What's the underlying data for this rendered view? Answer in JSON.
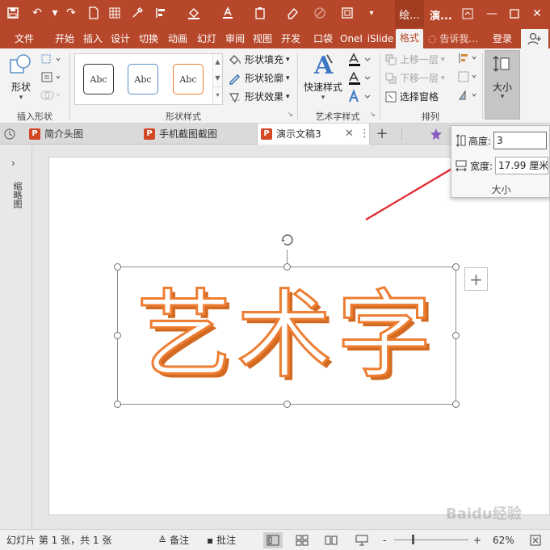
{
  "titlebar": {
    "context_group": "绘...",
    "doc_title": "演...",
    "icons": [
      "save-icon",
      "undo-icon",
      "redo-icon",
      "new-doc-icon",
      "grid-icon",
      "eyedropper-icon",
      "align-icon",
      "fill-bucket-icon",
      "font-color-icon",
      "clipboard-icon",
      "eraser-icon",
      "disabled-icon",
      "window-capture-icon"
    ]
  },
  "tabs": [
    {
      "label": "文件"
    },
    {
      "label": "开始"
    },
    {
      "label": "插入"
    },
    {
      "label": "设计"
    },
    {
      "label": "切换"
    },
    {
      "label": "动画"
    },
    {
      "label": "幻灯"
    },
    {
      "label": "审阅"
    },
    {
      "label": "视图"
    },
    {
      "label": "开发"
    },
    {
      "label": "口袋"
    },
    {
      "label": "OneI"
    },
    {
      "label": "iSlide"
    },
    {
      "label": "格式"
    }
  ],
  "tell_me": "告诉我...",
  "login": "登录",
  "ribbon": {
    "insert_shape": {
      "shape_label": "形状",
      "group_label": "插入形状"
    },
    "shape_styles": {
      "gallery": [
        "Abc",
        "Abc",
        "Abc"
      ],
      "fill": "形状填充",
      "outline": "形状轮廓",
      "effects": "形状效果",
      "group_label": "形状样式"
    },
    "wordart": {
      "quick_styles": "快速样式",
      "group_label": "艺术字样式"
    },
    "arrange": {
      "bring_forward": "上移一层",
      "send_backward": "下移一层",
      "selection_pane": "选择窗格",
      "group_label": "排列"
    },
    "size": {
      "label": "大小"
    }
  },
  "doc_tabs": [
    {
      "label": "简介头图"
    },
    {
      "label": "手机截图截图"
    },
    {
      "label": "演示文稿3"
    }
  ],
  "thumbs_label": "缩略图",
  "slide": {
    "wordart_text": "艺术字"
  },
  "size_popup": {
    "height_label": "高度:",
    "height_value": "3",
    "width_label": "宽度:",
    "width_value": "17.99 厘米",
    "footer": "大小"
  },
  "status": {
    "slide_info": "幻灯片 第 1 张，共 1 张",
    "notes": "备注",
    "comments": "批注",
    "zoom_minus": "-",
    "zoom_plus": "+",
    "zoom": "62%"
  },
  "watermark": "Baidu经验",
  "colors": {
    "accent": "#b7472a",
    "wordart_outline": "#ed7d31",
    "arrow": "#e0262c"
  }
}
